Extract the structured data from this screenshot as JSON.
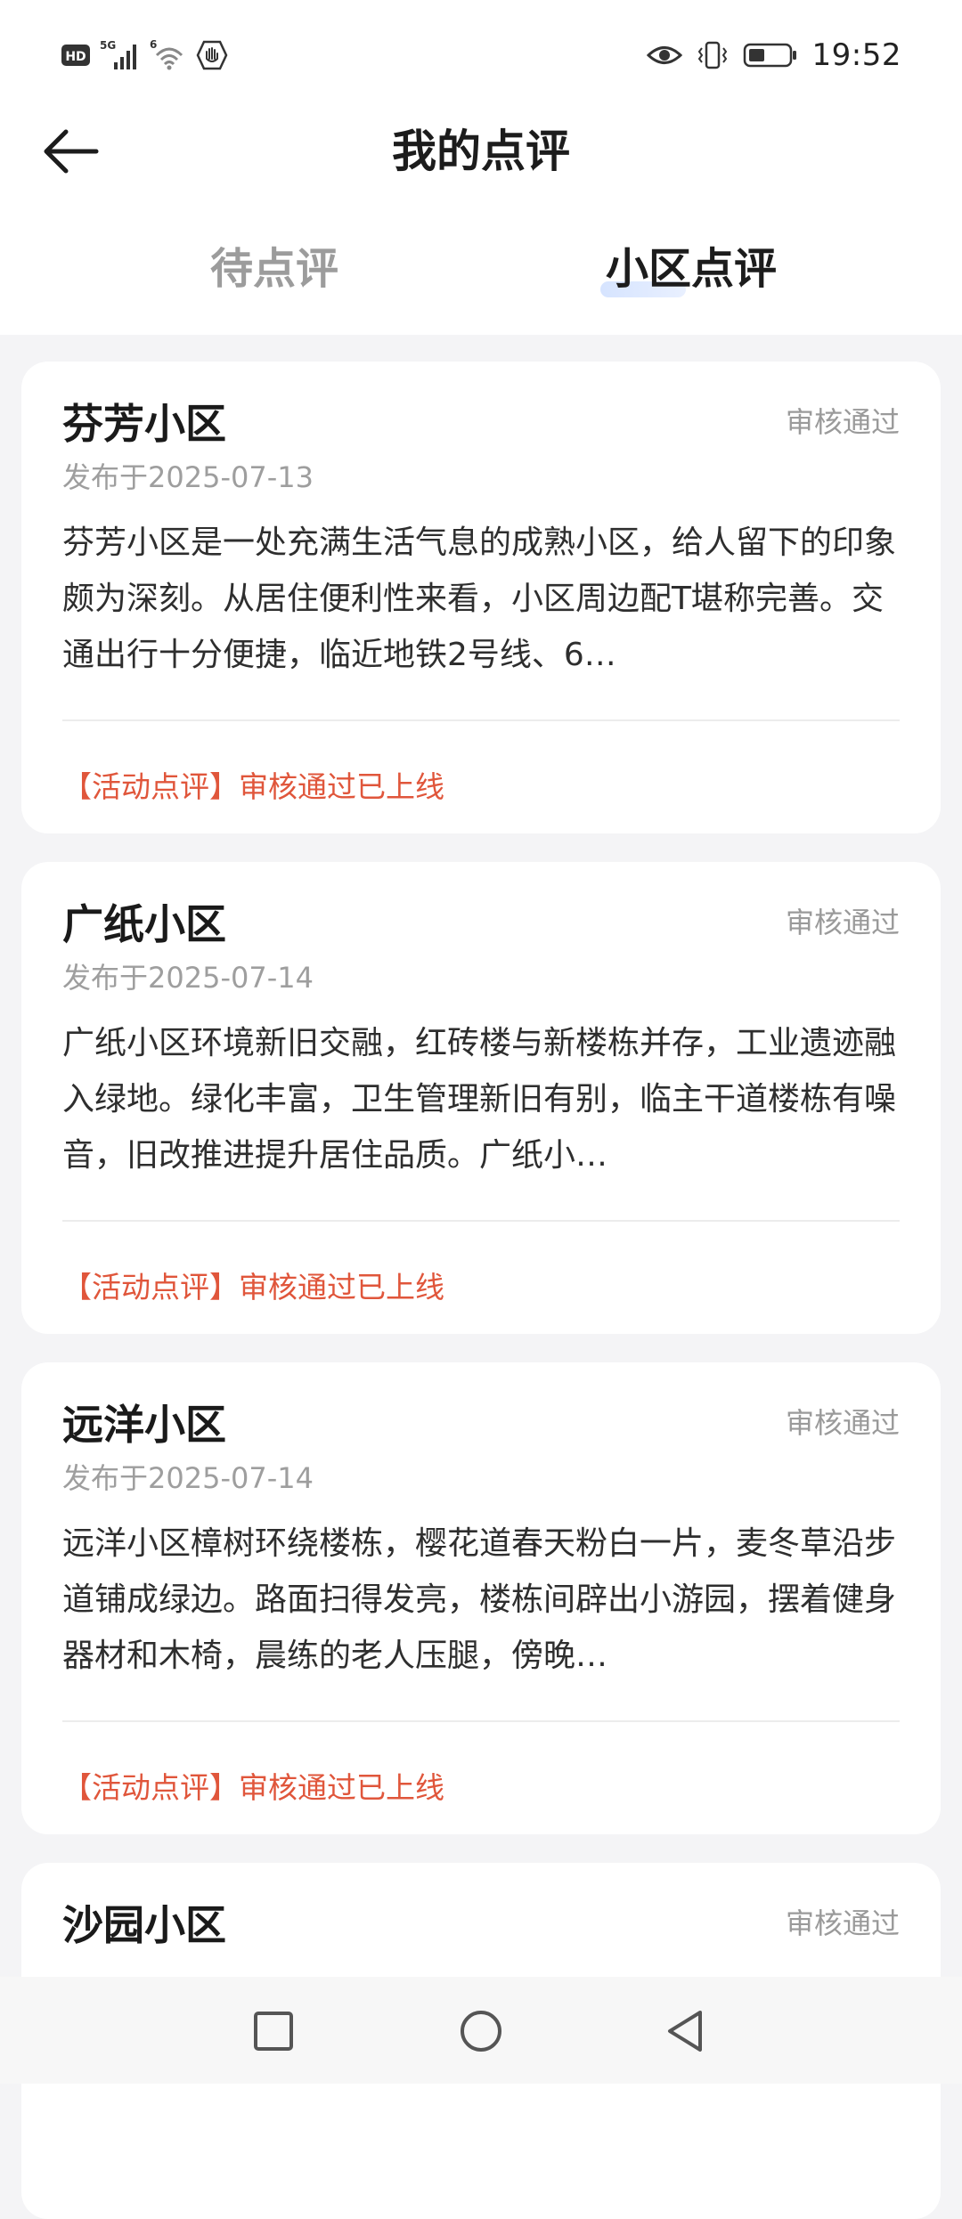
{
  "status_bar": {
    "hd_badge": "HD",
    "network_label": "5G",
    "wifi_label": "6",
    "time": "19:52",
    "icons": [
      "hd-icon",
      "signal-icon",
      "wifi-icon",
      "hand-icon",
      "eye-icon",
      "vibrate-icon",
      "battery-icon"
    ]
  },
  "header": {
    "title": "我的点评",
    "back_icon": "arrow-left-icon"
  },
  "tabs": [
    {
      "label": "待点评",
      "active": false
    },
    {
      "label": "小区点评",
      "active": true
    }
  ],
  "colors": {
    "accent_red": "#e0563b",
    "tab_underline": "#d6e4ff",
    "status_gray": "#9a9a9a"
  },
  "reviews": [
    {
      "title": "芬芳小区",
      "status": "审核通过",
      "date": "发布于2025-07-13",
      "content": "芬芳小区是一处充满生活气息的成熟小区，给人留下的印象颇为深刻。从居住便利性来看，小区周边配T堪称完善。交通出行十分便捷，临近地铁2号线、6…",
      "footer": "【活动点评】审核通过已上线"
    },
    {
      "title": "广纸小区",
      "status": "审核通过",
      "date": "发布于2025-07-14",
      "content": "广纸小区环境新旧交融，红砖楼与新楼栋并存，工业遗迹融入绿地。绿化丰富，卫生管理新旧有别，临主干道楼栋有噪音，旧改推进提升居住品质。广纸小…",
      "footer": "【活动点评】审核通过已上线"
    },
    {
      "title": "远洋小区",
      "status": "审核通过",
      "date": "发布于2025-07-14",
      "content": "远洋小区樟树环绕楼栋，樱花道春天粉白一片，麦冬草沿步道铺成绿边。路面扫得发亮，楼栋间辟出小游园，摆着健身器材和木椅，晨练的老人压腿，傍晚…",
      "footer": "【活动点评】审核通过已上线"
    },
    {
      "title": "沙园小区",
      "status": "审核通过"
    }
  ],
  "nav_bar": {
    "icons": [
      "recents-square-icon",
      "home-circle-icon",
      "back-triangle-icon"
    ]
  }
}
